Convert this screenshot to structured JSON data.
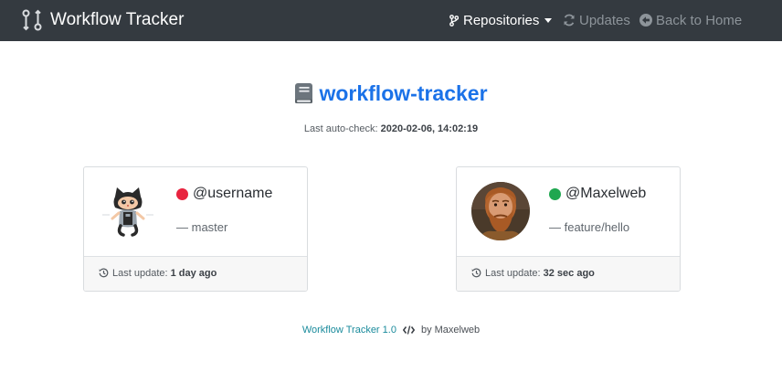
{
  "navbar": {
    "brand": {
      "title": "Workflow Tracker",
      "icon": "git-compare-icon"
    },
    "items": [
      {
        "label": "Repositories",
        "icon": "git-branch-icon",
        "has_caret": true,
        "active": true
      },
      {
        "label": "Updates",
        "icon": "refresh-icon",
        "active": false
      },
      {
        "label": "Back to Home",
        "icon": "arrow-circle-left-icon",
        "active": false
      }
    ]
  },
  "repo": {
    "name": "workflow-tracker",
    "icon": "book-icon",
    "autocheck_label": "Last auto-check:",
    "autocheck_value": "2020-02-06, 14:02:19"
  },
  "cards": [
    {
      "username": "@username",
      "branch": "— master",
      "status_color": "#e8243f",
      "avatar": "octocat-avatar",
      "update_label": "Last update:",
      "update_value": "1 day ago"
    },
    {
      "username": "@Maxelweb",
      "branch": "— feature/hello",
      "status_color": "#1fa750",
      "avatar": "user-photo-avatar",
      "update_label": "Last update:",
      "update_value": "32 sec ago"
    }
  ],
  "footer": {
    "app_link": "Workflow Tracker 1.0",
    "icon": "code-icon",
    "by_text": "by Maxelweb"
  },
  "colors": {
    "navbar_bg": "#343a40",
    "link_blue": "#1b72e8",
    "footer_link": "#1a8b9c",
    "status_red": "#e8243f",
    "status_green": "#1fa750"
  }
}
